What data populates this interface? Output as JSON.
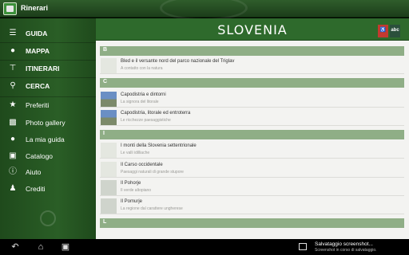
{
  "app": {
    "title": "Rinerari"
  },
  "header": {
    "title": "SLOVENIA"
  },
  "sidebar": {
    "primary": [
      {
        "icon": "list-icon",
        "label": "GUIDA"
      },
      {
        "icon": "map-pin-icon",
        "label": "MAPPA"
      },
      {
        "icon": "signpost-icon",
        "label": "ITINERARI"
      },
      {
        "icon": "search-icon",
        "label": "CERCA"
      }
    ],
    "secondary": [
      {
        "icon": "star-icon",
        "label": "Preferiti"
      },
      {
        "icon": "camera-icon",
        "label": "Photo gallery"
      },
      {
        "icon": "map-pin-icon",
        "label": "La mia guida"
      },
      {
        "icon": "book-icon",
        "label": "Catalogo"
      },
      {
        "icon": "info-icon",
        "label": "Aiuto"
      },
      {
        "icon": "people-icon",
        "label": "Crediti"
      }
    ]
  },
  "tags": {
    "red": "♿",
    "dark": "abc"
  },
  "list": {
    "sections": [
      {
        "letter": "B",
        "rows": [
          {
            "name": "Bled e il versante nord del parco nazionale del Triglav",
            "sub": "A contatto con la natura"
          }
        ]
      },
      {
        "letter": "C",
        "rows": [
          {
            "name": "Capodistria e dintorni",
            "sub": "La signora del litorale"
          },
          {
            "name": "Capodistria, litorale ed entroterra",
            "sub": "Le ricchezze paesaggistiche"
          }
        ]
      },
      {
        "letter": "I",
        "rows": [
          {
            "name": "I monti della Slovenia settentrionale",
            "sub": "Le valli idilliache"
          },
          {
            "name": "Il Carso occidentale",
            "sub": "Paesaggi naturali di grande stupore"
          },
          {
            "name": "Il Pohorje",
            "sub": "Il verde altopiano"
          },
          {
            "name": "Il Pomurje",
            "sub": "La regione dal carattere ungherese"
          }
        ]
      },
      {
        "letter": "L",
        "rows": []
      }
    ]
  },
  "notification": {
    "title": "Salvataggio screenshot...",
    "sub": "Screenshot in corso di salvataggio."
  },
  "navbar": {
    "back": "↶",
    "home": "⌂",
    "recent": "▣"
  }
}
